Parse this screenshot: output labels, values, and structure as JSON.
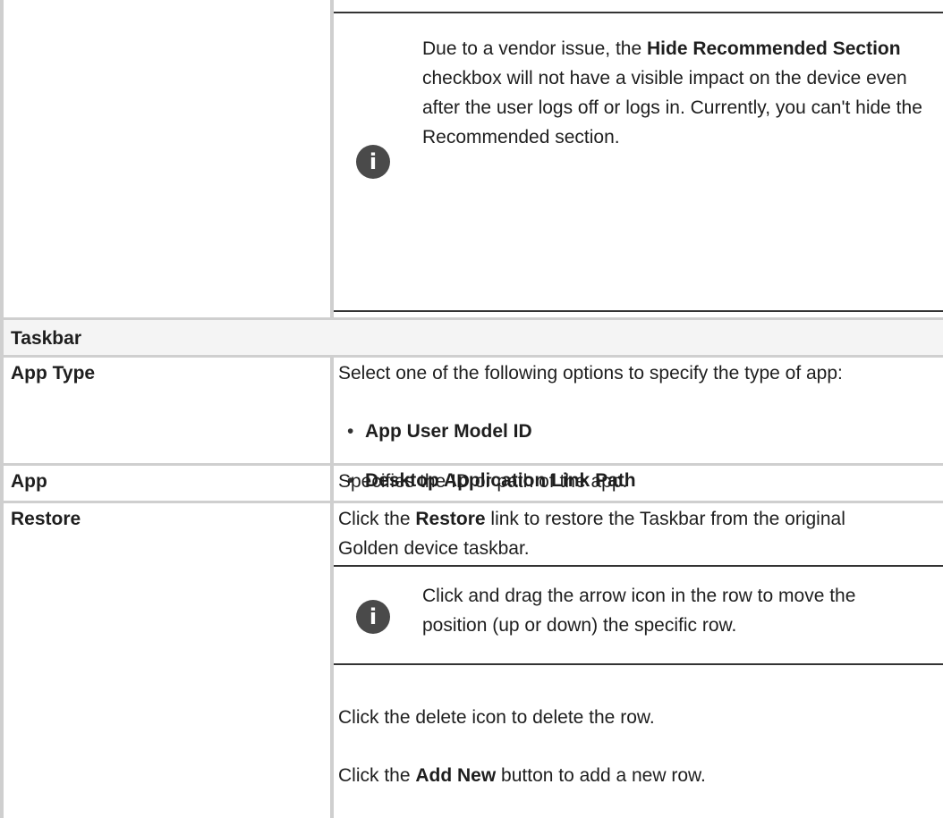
{
  "note_top": {
    "pre": "Due to a vendor issue, the ",
    "bold": "Hide Recommended Section",
    "post": " checkbox will not have a visible impact on the device even after the user logs off or logs in. Currently, you can't hide the Recommended section."
  },
  "section_header": "Taskbar",
  "rows": {
    "app_type": {
      "label": "App Type",
      "desc": "Select one of the following options to specify the type of app:",
      "options": [
        "App User Model ID",
        "Desktop Application Link Path"
      ]
    },
    "app": {
      "label": "App",
      "desc": "Specifies the ID or path of the app."
    },
    "restore": {
      "label": "Restore",
      "desc_pre": "Click the ",
      "desc_bold": "Restore",
      "desc_post": " link to restore the Taskbar from the original Golden device taskbar.",
      "note": "Click and drag the arrow icon in the row to move the position (up or down) the specific row.",
      "delete_text": "Click the delete icon to delete the row.",
      "add_pre": "Click the ",
      "add_bold": "Add New",
      "add_post": " button to add a new row."
    }
  }
}
